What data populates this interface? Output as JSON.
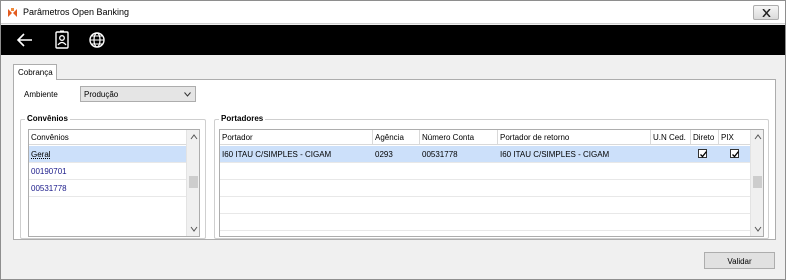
{
  "window": {
    "title": "Parâmetros Open Banking"
  },
  "toolbar": {
    "buttons": [
      {
        "icon": "back-arrow-icon"
      },
      {
        "icon": "id-card-icon"
      },
      {
        "icon": "globe-icon"
      }
    ]
  },
  "tabs": [
    {
      "label": "Cobrança"
    }
  ],
  "ambiente": {
    "label": "Ambiente",
    "value": "Produção"
  },
  "convenios": {
    "title": "Convênios",
    "header": "Convênios",
    "rows": [
      "Geral",
      "00190701",
      "00531778"
    ]
  },
  "portadores": {
    "title": "Portadores",
    "columns": [
      "Portador",
      "Agência",
      "Número Conta",
      "Portador de retorno",
      "U.N Ced.",
      "Direto",
      "PIX"
    ],
    "rows": [
      {
        "portador": "I60   ITAU C/SIMPLES - CIGAM",
        "agencia": "0293",
        "conta": "00531778",
        "retorno": "I60   ITAU C/SIMPLES - CIGAM",
        "un_ced": "",
        "direto": true,
        "pix": true
      }
    ]
  },
  "footer": {
    "validar_label": "Validar"
  }
}
